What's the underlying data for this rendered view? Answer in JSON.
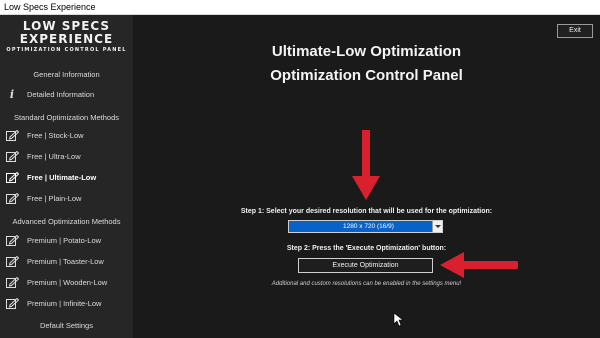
{
  "window": {
    "title": "Low Specs Experience"
  },
  "logo": {
    "line1": "LOW SPECS",
    "line2": "EXPERIENCE",
    "line3": "OPTIMIZATION CONTROL PANEL"
  },
  "sidebar": {
    "general_header": "General Information",
    "detailed_info": "Detailed Information",
    "standard_header": "Standard Optimization Methods",
    "standard_items": [
      {
        "label": "Free | Stock-Low"
      },
      {
        "label": "Free | Ultra-Low"
      },
      {
        "label": "Free | Ultimate-Low",
        "active": true
      },
      {
        "label": "Free | Plain-Low"
      }
    ],
    "advanced_header": "Advanced Optimization Methods",
    "advanced_items": [
      {
        "label": "Premium | Potato-Low"
      },
      {
        "label": "Premium | Toaster-Low"
      },
      {
        "label": "Premium | Wooden-Low"
      },
      {
        "label": "Premium | Infinite-Low"
      }
    ],
    "default_settings": "Default Settings"
  },
  "main": {
    "exit_label": "Exit",
    "title_line1": "Ultimate-Low Optimization",
    "title_line2": "Optimization Control Panel",
    "step1": "Step 1: Select your desired resolution that will be used for the optimization:",
    "resolution_selected": "1280 x 720 (16/9)",
    "step2": "Step 2: Press the 'Execute Optimization' button:",
    "execute_label": "Execute Optimization",
    "note": "Additional and custom resolutions can be enabled in the settings menu!"
  },
  "colors": {
    "sidebar_bg": "#262626",
    "main_bg": "#1a1a1a",
    "select_bg": "#0a62c8",
    "arrow_red": "#d9202f"
  },
  "icons": {
    "info": "info-icon",
    "menu_item": "edit-icon"
  }
}
